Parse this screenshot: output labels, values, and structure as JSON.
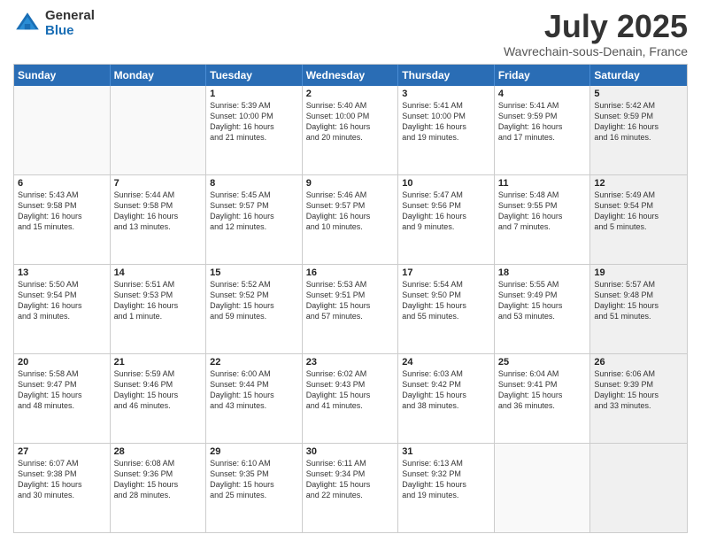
{
  "header": {
    "logo_general": "General",
    "logo_blue": "Blue",
    "month_title": "July 2025",
    "location": "Wavrechain-sous-Denain, France"
  },
  "weekdays": [
    "Sunday",
    "Monday",
    "Tuesday",
    "Wednesday",
    "Thursday",
    "Friday",
    "Saturday"
  ],
  "rows": [
    [
      {
        "day": "",
        "info": "",
        "empty": true
      },
      {
        "day": "",
        "info": "",
        "empty": true
      },
      {
        "day": "1",
        "info": "Sunrise: 5:39 AM\nSunset: 10:00 PM\nDaylight: 16 hours\nand 21 minutes."
      },
      {
        "day": "2",
        "info": "Sunrise: 5:40 AM\nSunset: 10:00 PM\nDaylight: 16 hours\nand 20 minutes."
      },
      {
        "day": "3",
        "info": "Sunrise: 5:41 AM\nSunset: 10:00 PM\nDaylight: 16 hours\nand 19 minutes."
      },
      {
        "day": "4",
        "info": "Sunrise: 5:41 AM\nSunset: 9:59 PM\nDaylight: 16 hours\nand 17 minutes."
      },
      {
        "day": "5",
        "info": "Sunrise: 5:42 AM\nSunset: 9:59 PM\nDaylight: 16 hours\nand 16 minutes.",
        "shaded": true
      }
    ],
    [
      {
        "day": "6",
        "info": "Sunrise: 5:43 AM\nSunset: 9:58 PM\nDaylight: 16 hours\nand 15 minutes."
      },
      {
        "day": "7",
        "info": "Sunrise: 5:44 AM\nSunset: 9:58 PM\nDaylight: 16 hours\nand 13 minutes."
      },
      {
        "day": "8",
        "info": "Sunrise: 5:45 AM\nSunset: 9:57 PM\nDaylight: 16 hours\nand 12 minutes."
      },
      {
        "day": "9",
        "info": "Sunrise: 5:46 AM\nSunset: 9:57 PM\nDaylight: 16 hours\nand 10 minutes."
      },
      {
        "day": "10",
        "info": "Sunrise: 5:47 AM\nSunset: 9:56 PM\nDaylight: 16 hours\nand 9 minutes."
      },
      {
        "day": "11",
        "info": "Sunrise: 5:48 AM\nSunset: 9:55 PM\nDaylight: 16 hours\nand 7 minutes."
      },
      {
        "day": "12",
        "info": "Sunrise: 5:49 AM\nSunset: 9:54 PM\nDaylight: 16 hours\nand 5 minutes.",
        "shaded": true
      }
    ],
    [
      {
        "day": "13",
        "info": "Sunrise: 5:50 AM\nSunset: 9:54 PM\nDaylight: 16 hours\nand 3 minutes."
      },
      {
        "day": "14",
        "info": "Sunrise: 5:51 AM\nSunset: 9:53 PM\nDaylight: 16 hours\nand 1 minute."
      },
      {
        "day": "15",
        "info": "Sunrise: 5:52 AM\nSunset: 9:52 PM\nDaylight: 15 hours\nand 59 minutes."
      },
      {
        "day": "16",
        "info": "Sunrise: 5:53 AM\nSunset: 9:51 PM\nDaylight: 15 hours\nand 57 minutes."
      },
      {
        "day": "17",
        "info": "Sunrise: 5:54 AM\nSunset: 9:50 PM\nDaylight: 15 hours\nand 55 minutes."
      },
      {
        "day": "18",
        "info": "Sunrise: 5:55 AM\nSunset: 9:49 PM\nDaylight: 15 hours\nand 53 minutes."
      },
      {
        "day": "19",
        "info": "Sunrise: 5:57 AM\nSunset: 9:48 PM\nDaylight: 15 hours\nand 51 minutes.",
        "shaded": true
      }
    ],
    [
      {
        "day": "20",
        "info": "Sunrise: 5:58 AM\nSunset: 9:47 PM\nDaylight: 15 hours\nand 48 minutes."
      },
      {
        "day": "21",
        "info": "Sunrise: 5:59 AM\nSunset: 9:46 PM\nDaylight: 15 hours\nand 46 minutes."
      },
      {
        "day": "22",
        "info": "Sunrise: 6:00 AM\nSunset: 9:44 PM\nDaylight: 15 hours\nand 43 minutes."
      },
      {
        "day": "23",
        "info": "Sunrise: 6:02 AM\nSunset: 9:43 PM\nDaylight: 15 hours\nand 41 minutes."
      },
      {
        "day": "24",
        "info": "Sunrise: 6:03 AM\nSunset: 9:42 PM\nDaylight: 15 hours\nand 38 minutes."
      },
      {
        "day": "25",
        "info": "Sunrise: 6:04 AM\nSunset: 9:41 PM\nDaylight: 15 hours\nand 36 minutes."
      },
      {
        "day": "26",
        "info": "Sunrise: 6:06 AM\nSunset: 9:39 PM\nDaylight: 15 hours\nand 33 minutes.",
        "shaded": true
      }
    ],
    [
      {
        "day": "27",
        "info": "Sunrise: 6:07 AM\nSunset: 9:38 PM\nDaylight: 15 hours\nand 30 minutes."
      },
      {
        "day": "28",
        "info": "Sunrise: 6:08 AM\nSunset: 9:36 PM\nDaylight: 15 hours\nand 28 minutes."
      },
      {
        "day": "29",
        "info": "Sunrise: 6:10 AM\nSunset: 9:35 PM\nDaylight: 15 hours\nand 25 minutes."
      },
      {
        "day": "30",
        "info": "Sunrise: 6:11 AM\nSunset: 9:34 PM\nDaylight: 15 hours\nand 22 minutes."
      },
      {
        "day": "31",
        "info": "Sunrise: 6:13 AM\nSunset: 9:32 PM\nDaylight: 15 hours\nand 19 minutes."
      },
      {
        "day": "",
        "info": "",
        "empty": true
      },
      {
        "day": "",
        "info": "",
        "empty": true,
        "shaded": true
      }
    ]
  ]
}
